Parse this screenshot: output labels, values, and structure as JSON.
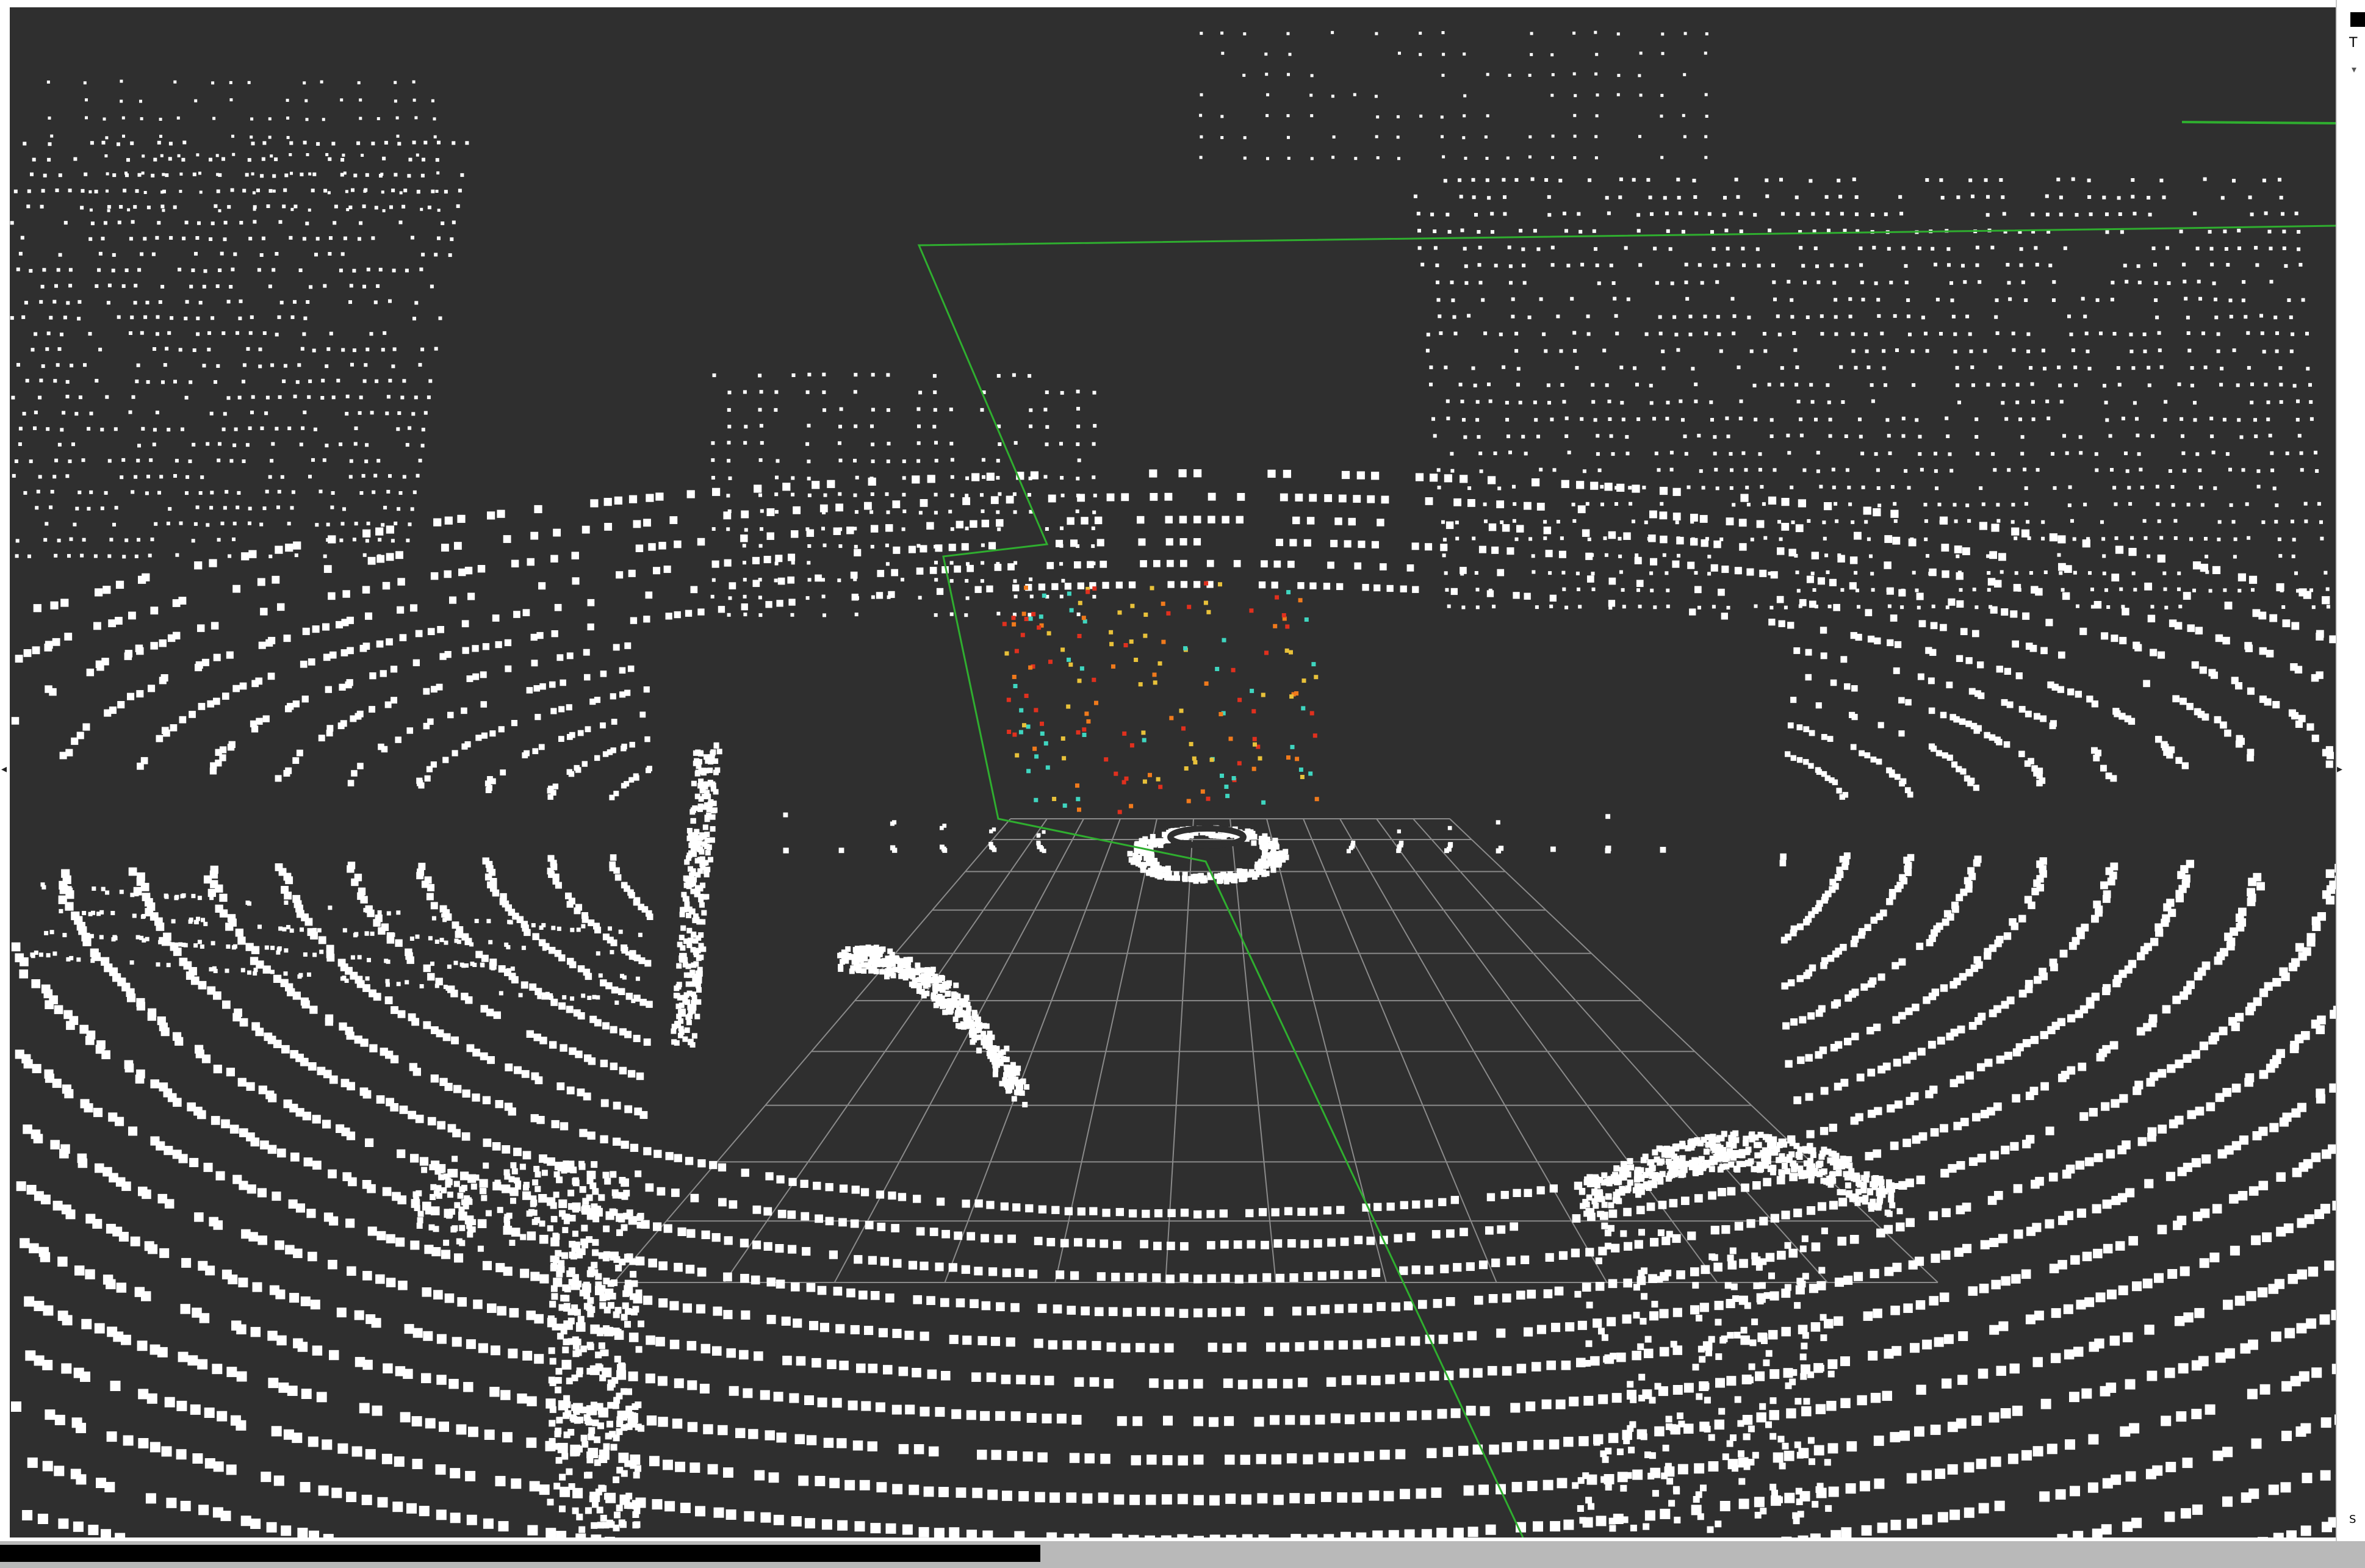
{
  "colors": {
    "background": "#2f2f2f",
    "points": "#ffffff",
    "path": "#2fae2f",
    "grid": "#8a8a8a",
    "highlight_points": [
      "#e0301e",
      "#f07a1c",
      "#e8c13a",
      "#3fd6c0"
    ]
  },
  "viewport": {
    "description_icon": "point-cloud-viewport-icon"
  },
  "right_panel": {
    "label": "T",
    "arrow_icon": "chevron-down-icon",
    "footer": "S"
  },
  "handles": {
    "left_icon": "collapse-left-icon",
    "right_icon": "collapse-right-icon",
    "left_glyph": "◂",
    "right_glyph": "▸"
  },
  "progress": {
    "fraction": 0.44
  }
}
